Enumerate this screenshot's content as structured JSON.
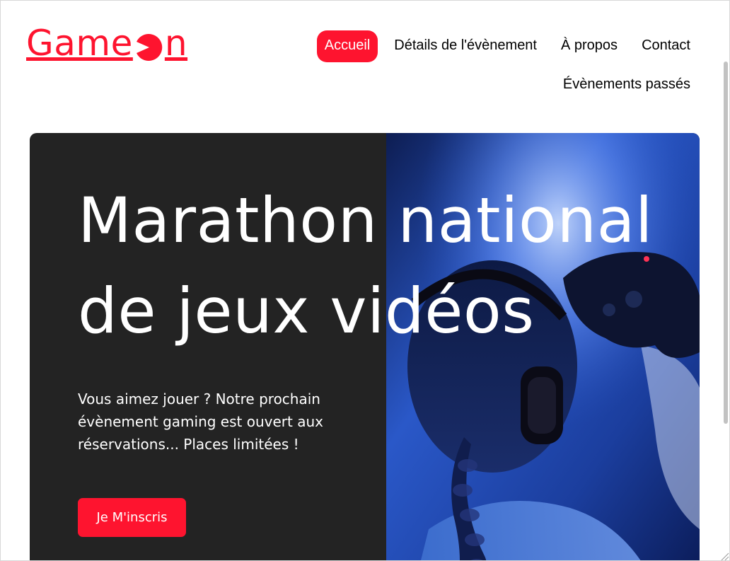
{
  "header": {
    "logo_text_start": "Game",
    "logo_text_end": "n",
    "logo_icon": "pacman-icon",
    "brand_color": "#fe142f"
  },
  "nav": {
    "items": [
      {
        "label": "Accueil",
        "active": true
      },
      {
        "label": "Détails de l'évènement",
        "active": false
      },
      {
        "label": "À propos",
        "active": false
      },
      {
        "label": "Contact",
        "active": false
      },
      {
        "label": "Évènements passés",
        "active": false
      }
    ]
  },
  "hero": {
    "title": "Marathon national de jeux vidéos",
    "text": "Vous aimez jouer ? Notre prochain évènement gaming est ouvert aux réservations... Places limitées !",
    "button_label": "Je M'inscris",
    "background_color": "#232323",
    "image": "gamer-with-headset-and-controller"
  }
}
